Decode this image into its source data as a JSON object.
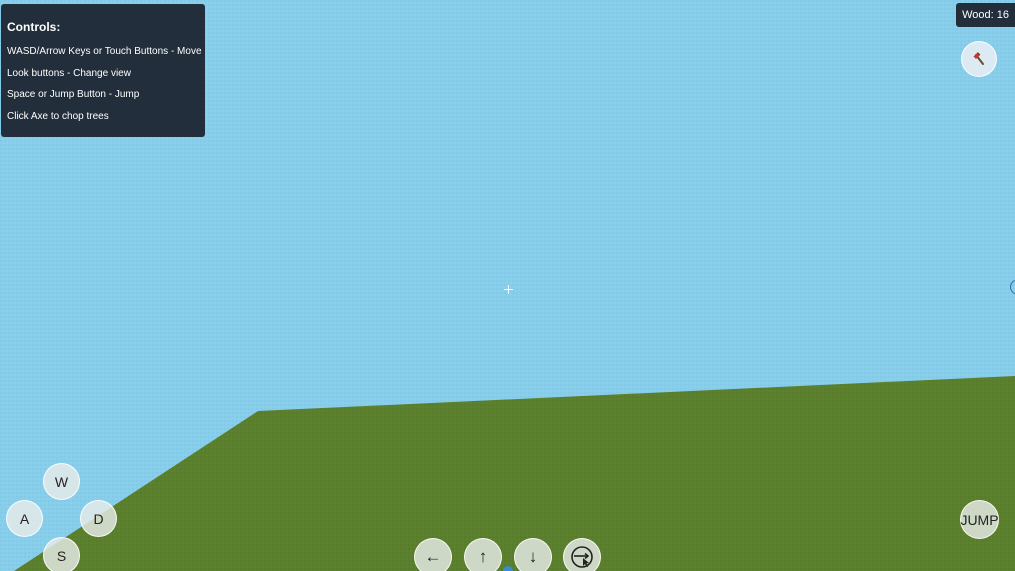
{
  "controls": {
    "title": "Controls:",
    "lines": [
      "WASD/Arrow Keys or Touch Buttons - Move",
      "Look buttons - Change view",
      "Space or Jump Button - Jump",
      "Click Axe to chop trees"
    ]
  },
  "hud": {
    "wood_label": "Wood: 16",
    "axe_icon": "axe-icon"
  },
  "movement": {
    "w": "W",
    "a": "A",
    "s": "S",
    "d": "D",
    "jump": "JUMP"
  },
  "look": {
    "left": "←",
    "up": "↑",
    "down": "↓",
    "lock_icon": "pointer-lock-icon"
  },
  "colors": {
    "sky": "#87ceeb",
    "ground": "#5a7f2d",
    "panel": "#141822"
  }
}
